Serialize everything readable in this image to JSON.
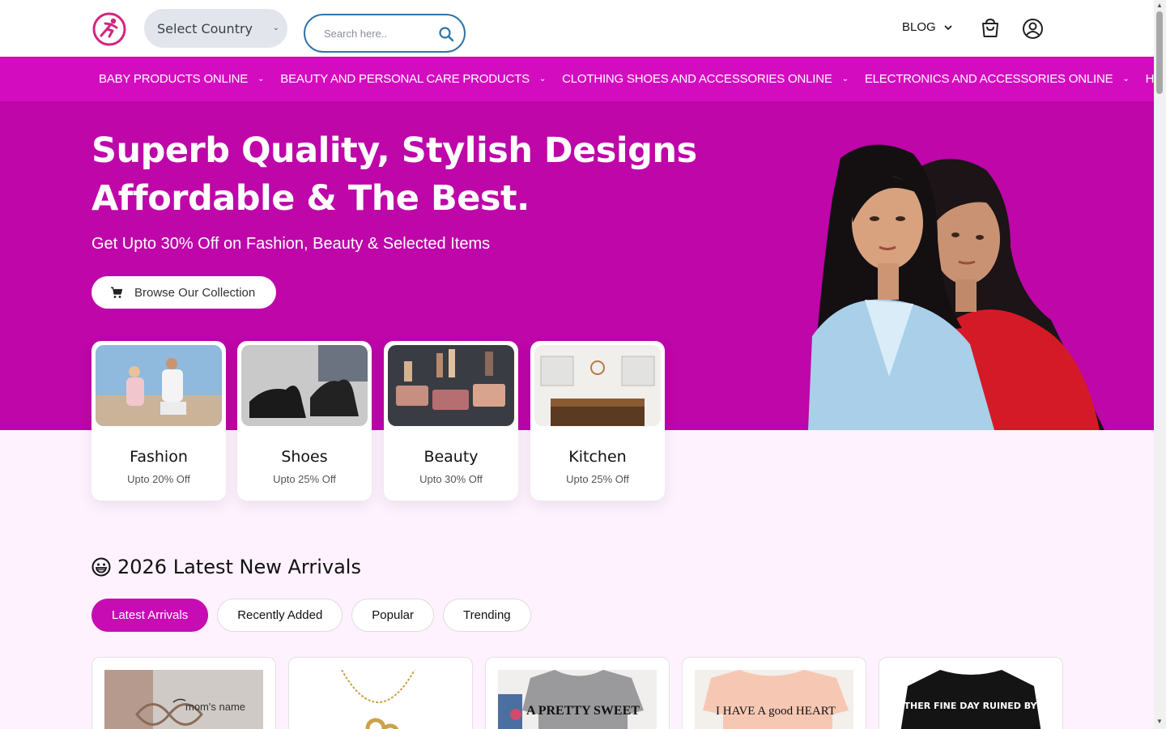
{
  "header": {
    "country_select": "Select Country",
    "search_placeholder": "Search here..",
    "blog_label": "BLOG"
  },
  "nav": {
    "items": [
      {
        "label": "BABY PRODUCTS ONLINE"
      },
      {
        "label": "BEAUTY AND PERSONAL CARE PRODUCTS"
      },
      {
        "label": "CLOTHING SHOES AND ACCESSORIES ONLINE"
      },
      {
        "label": "ELECTRONICS AND ACCESSORIES ONLINE"
      },
      {
        "label": "HOME AND"
      }
    ]
  },
  "hero": {
    "title_line1": "Superb Quality, Stylish Designs",
    "title_line2": "Affordable & The Best.",
    "subtitle": "Get Upto 30% Off on Fashion, Beauty & Selected Items",
    "cta": "Browse Our Collection"
  },
  "categories": [
    {
      "title": "Fashion",
      "discount": "Upto 20% Off"
    },
    {
      "title": "Shoes",
      "discount": "Upto 25% Off"
    },
    {
      "title": "Beauty",
      "discount": "Upto 30% Off"
    },
    {
      "title": "Kitchen",
      "discount": "Upto 25% Off"
    }
  ],
  "arrivals": {
    "title": "2026 Latest New Arrivals",
    "tabs": [
      {
        "label": "Latest Arrivals",
        "active": true
      },
      {
        "label": "Recently Added"
      },
      {
        "label": "Popular"
      },
      {
        "label": "Trending"
      }
    ],
    "product_texts": {
      "bracelet_engraving": "mom's name",
      "shirt1": "A PRETTY SWEET",
      "shirt2": "I HAVE A good HEART",
      "shirt3": "ANOTHER FINE DAY RUINED BY THE"
    }
  },
  "colors": {
    "brand": "#c70cb4",
    "nav_bg": "#d40cc0",
    "hero_bg": "#be06a9",
    "search_border": "#2f74a8"
  },
  "icons": [
    "logo-icon",
    "chevron-down-icon",
    "search-icon",
    "shopping-bag-icon",
    "user-circle-icon",
    "cart-icon",
    "grin-emoji-icon"
  ]
}
